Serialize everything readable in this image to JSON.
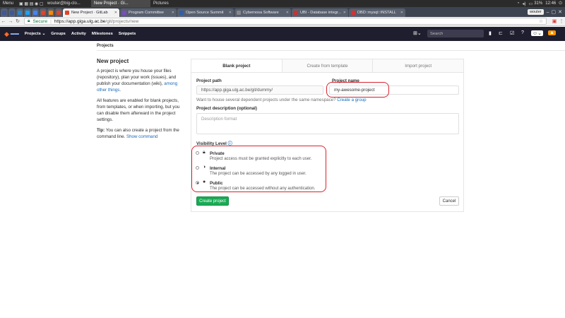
{
  "taskbar": {
    "menu": "Menu",
    "tasks": [
      "wouter@big-clo...",
      "New Project · Gi...",
      "Pictures"
    ],
    "battery": "31%",
    "time": "12:46"
  },
  "browser_tabs": [
    {
      "title": "New Project · GitLab",
      "active": true,
      "color": "#e24329"
    },
    {
      "title": "Program Committee",
      "active": false,
      "color": "#7b4cbf"
    },
    {
      "title": "Open Source Summit",
      "active": false,
      "color": "#2f5fa7"
    },
    {
      "title": "Cybernosa Software",
      "active": false,
      "color": "#888888"
    },
    {
      "title": "UBI - Database integr...",
      "active": false,
      "color": "#c83232"
    },
    {
      "title": "DBD::mysql::INSTALL",
      "active": false,
      "color": "#d83030"
    }
  ],
  "browser_user": "wouter",
  "address_bar": {
    "secure": "Secure",
    "host": "https://app.giga.ulg.ac.be",
    "path": "/git/projects/new"
  },
  "gitlab_nav": {
    "items": [
      "Projects",
      "Groups",
      "Activity",
      "Milestones",
      "Snippets"
    ],
    "search_placeholder": "Search"
  },
  "breadcrumb": "Projects",
  "sidebar": {
    "title": "New project",
    "intro_text": "A project is where you house your files (repository), plan your work (issues), and publish your documentation (wiki), ",
    "intro_link": "among other things",
    "intro_end": ".",
    "features_text": "All features are enabled for blank projects, from templates, or when importing, but you can disable them afterward in the project settings.",
    "tip_label": "Tip:",
    "tip_text": " You can also create a project from the command line. ",
    "tip_link": "Show command"
  },
  "tabs": [
    "Blank project",
    "Create from template",
    "Import project"
  ],
  "form": {
    "path_label": "Project path",
    "path_value": "https://app.giga.ulg.ac.be/git/dummy/",
    "name_label": "Project name",
    "name_value": "my-awesome-project",
    "namespace_help": "Want to house several dependent projects under the same namespace? ",
    "namespace_link": "Create a group",
    "description_label": "Project description (optional)",
    "description_placeholder": "Description format",
    "visibility_label": "Visibility Level",
    "visibility_options": [
      {
        "name": "Private",
        "description": "Project access must be granted explicitly to each user.",
        "icon": "lock-icon",
        "checked": false
      },
      {
        "name": "Internal",
        "description": "The project can be accessed by any logged in user.",
        "icon": "shield-icon",
        "checked": false
      },
      {
        "name": "Public",
        "description": "The project can be accessed without any authentication.",
        "icon": "globe-icon",
        "checked": true
      }
    ],
    "create_button": "Create project",
    "cancel_button": "Cancel"
  },
  "colors": {
    "gitlab_nav_bg": "#1f1e2e",
    "create_button": "#1aaa55",
    "annotation": "#d9232d",
    "link": "#1b69b6"
  }
}
